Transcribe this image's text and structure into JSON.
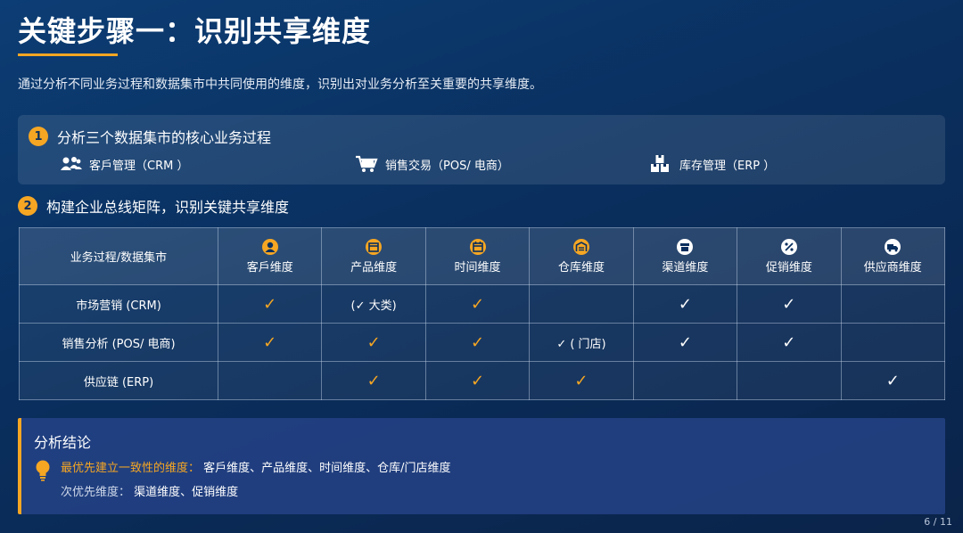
{
  "title": "关键步骤一：识别共享维度",
  "subtitle": "通过分析不同业务过程和数据集市中共同使用的维度，识别出对业务分析至关重要的共享维度。",
  "colors": {
    "accent": "#f5a623",
    "background": "#0a2f5e"
  },
  "step1": {
    "number": "1",
    "title": "分析三个数据集市的核心业务过程",
    "processes": [
      {
        "icon": "users-icon",
        "label": "客戶管理（CRM ）"
      },
      {
        "icon": "shopping-cart-icon",
        "label": "销售交易（POS/ 电商）"
      },
      {
        "icon": "boxes-icon",
        "label": "库存管理（ERP ）"
      }
    ]
  },
  "step2": {
    "number": "2",
    "title": "构建企业总线矩阵，识别关键共享维度"
  },
  "matrix": {
    "corner": "业务过程/数据集市",
    "columns": [
      {
        "icon": "user-circle-icon",
        "label": "客戶维度"
      },
      {
        "icon": "box-icon",
        "label": "产品维度"
      },
      {
        "icon": "calendar-icon",
        "label": "时间维度"
      },
      {
        "icon": "warehouse-icon",
        "label": "仓库维度"
      },
      {
        "icon": "store-icon",
        "label": "渠道维度"
      },
      {
        "icon": "percent-icon",
        "label": "促销维度"
      },
      {
        "icon": "truck-icon",
        "label": "供应商维度"
      }
    ],
    "rows": [
      {
        "label": "市场营销 (CRM)",
        "cells": [
          "✓o",
          "(✓ 大类)",
          "✓o",
          "",
          "✓w",
          "✓w",
          ""
        ]
      },
      {
        "label": "销售分析 (POS/ 电商)",
        "cells": [
          "✓o",
          "✓o",
          "✓o",
          "✓ ( 门店)",
          "✓w",
          "✓w",
          ""
        ]
      },
      {
        "label": "供应链 (ERP)",
        "cells": [
          "",
          "✓o",
          "✓o",
          "✓o",
          "",
          "",
          "✓w"
        ]
      }
    ]
  },
  "conclusion": {
    "title": "分析结论",
    "primary_label": "最优先建立一致性的维度：",
    "primary_value": "客戶维度、产品维度、时间维度、仓库/门店维度",
    "secondary_label": "次优先维度：",
    "secondary_value": "渠道维度、促销维度"
  },
  "pager": "6 / 11"
}
